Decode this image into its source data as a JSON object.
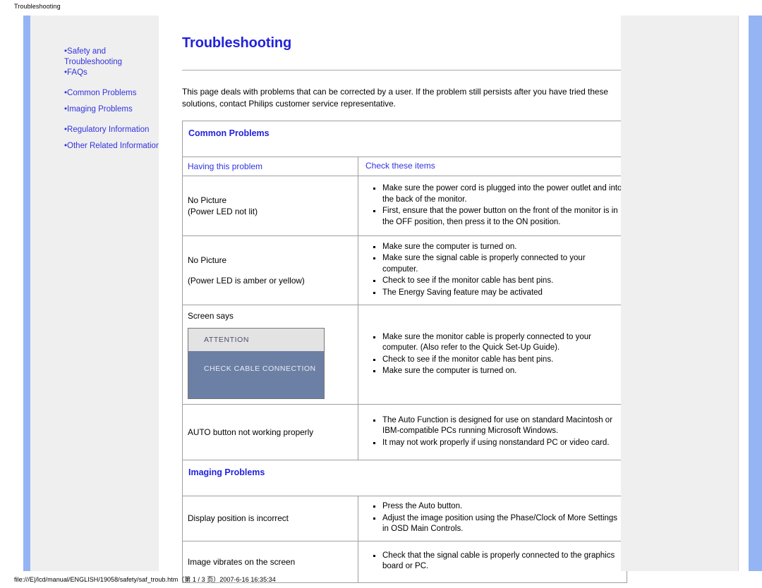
{
  "print_header": "Troubleshooting",
  "print_footer": "file:///E|/lcd/manual/ENGLISH/19058/safety/saf_troub.htm（第 1 / 3 页）2007-6-16 16:35:34",
  "colors": {
    "link_blue": "#3333dd",
    "title_blue": "#2222dd",
    "rail_blue": "#94b4f4",
    "sidebar_gray": "#efefef",
    "attention_head_bg": "#e3e3e3",
    "attention_body_bg": "#6c80a5"
  },
  "sidebar": {
    "groups": [
      {
        "items": [
          {
            "label": "Safety and\n Troubleshooting",
            "name": "safety-and-troubleshooting"
          },
          {
            "label": "FAQs",
            "name": "faqs"
          }
        ]
      },
      {
        "items": [
          {
            "label": "Common Problems",
            "name": "common-problems"
          },
          {
            "label": "Imaging Problems",
            "name": "imaging-problems"
          }
        ]
      },
      {
        "items": [
          {
            "label": "Regulatory Information",
            "name": "regulatory-information"
          },
          {
            "label": "Other Related Information",
            "name": "other-related-information"
          }
        ]
      }
    ],
    "bullet": "•"
  },
  "main": {
    "title": "Troubleshooting",
    "intro": "This page deals with problems that can be corrected by a user. If the problem still persists after you have tried these solutions, contact Philips customer service representative."
  },
  "common_problems": {
    "section_title": "Common Problems",
    "header": {
      "problem": "Having this problem",
      "checks": "Check these items"
    },
    "rows": [
      {
        "problem_lines": [
          "No Picture",
          "(Power LED not lit)"
        ],
        "gap_after_first": false,
        "checks": [
          "Make sure the power cord is plugged into the power outlet and into the back of the monitor.",
          "First, ensure that the power button on the front of the monitor is in the OFF position, then press it to the ON position."
        ]
      },
      {
        "problem_lines": [
          "No Picture",
          "(Power LED is amber or yellow)"
        ],
        "gap_after_first": true,
        "checks": [
          "Make sure the computer is turned on.",
          "Make sure the signal cable is properly connected to your computer.",
          "Check to see if the monitor cable has bent pins.",
          "The Energy Saving feature may be activated"
        ]
      },
      {
        "problem_lines": [
          "Screen says"
        ],
        "gap_after_first": false,
        "attention": {
          "head": "ATTENTION",
          "body": "CHECK CABLE CONNECTION"
        },
        "checks": [
          "Make sure the monitor cable is properly connected to your computer. (Also refer to the Quick Set-Up Guide).",
          "Check to see if the monitor cable has bent pins.",
          "Make sure the computer is turned on."
        ]
      },
      {
        "problem_lines": [
          "AUTO button not working properly"
        ],
        "gap_after_first": false,
        "checks": [
          "The Auto Function is designed for use on standard Macintosh or IBM-compatible PCs running Microsoft Windows.",
          "It may not work properly if using nonstandard PC or video card."
        ]
      }
    ]
  },
  "imaging_problems": {
    "section_title": "Imaging Problems",
    "rows": [
      {
        "problem_lines": [
          "Display position is incorrect"
        ],
        "checks": [
          "Press the Auto button.",
          "Adjust the image position using the Phase/Clock of More Settings in OSD Main Controls."
        ]
      },
      {
        "problem_lines": [
          "Image vibrates on the screen"
        ],
        "checks": [
          "Check that the signal cable is properly connected to the graphics board or PC."
        ]
      }
    ]
  }
}
